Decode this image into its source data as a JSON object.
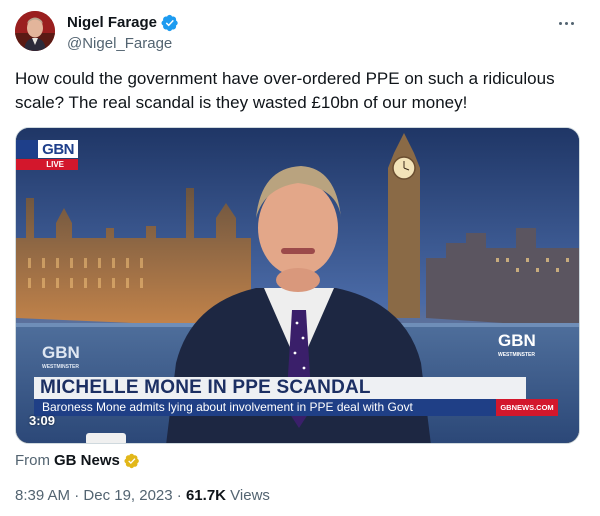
{
  "author": {
    "name": "Nigel Farage",
    "handle": "@Nigel_Farage"
  },
  "tweet": {
    "text": "How could the government have over-ordered PPE on such a ridiculous scale? The real scandal is they wasted £10bn of our money!"
  },
  "video": {
    "channel_logo": "GBN",
    "live_label": "LIVE",
    "headline": "MICHELLE MONE IN PPE SCANDAL",
    "subheadline": "Baroness Mone admits lying about involvement in PPE deal with Govt",
    "url_tag": "GBNEWS.COM",
    "duration": "3:09",
    "desk_logo_text": "GBN",
    "desk_logo_sub": "WESTMINSTER",
    "screen_logo_text": "GBN",
    "screen_logo_sub": "WESTMINSTER"
  },
  "source": {
    "prefix": "From",
    "name": "GB News"
  },
  "meta": {
    "time": "8:39 AM",
    "separator": "·",
    "date": "Dec 19, 2023",
    "views_count": "61.7K",
    "views_label": "Views"
  },
  "colors": {
    "verified_blue": "#1d9bf0",
    "gold_badge": "#e2b719",
    "gb_blue": "#1f3f86",
    "gb_red": "#d3172c"
  },
  "icons": {
    "verified": "verified-check-icon",
    "gold_badge": "gold-verified-icon",
    "more": "more-dots-icon"
  }
}
